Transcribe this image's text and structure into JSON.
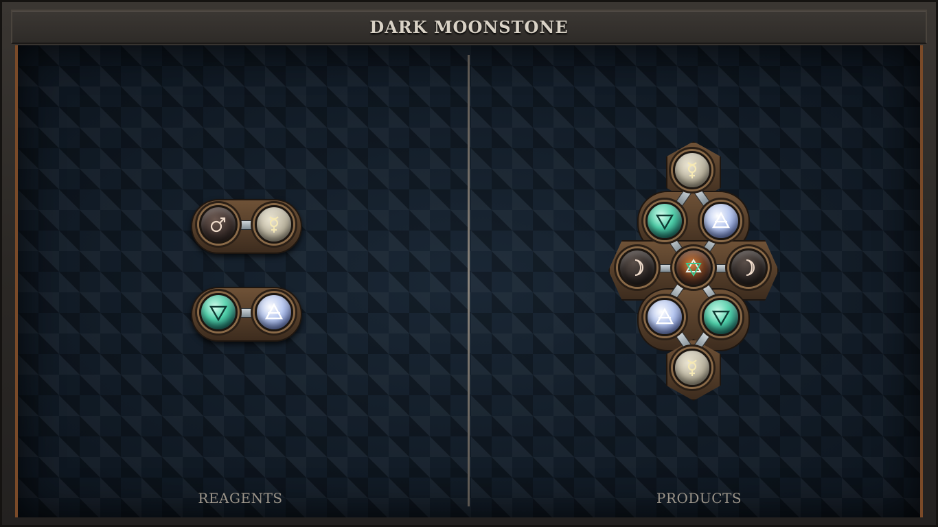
{
  "window": {
    "title": "DARK MOONSTONE"
  },
  "panels": {
    "left": {
      "label": "REAGENTS"
    },
    "right": {
      "label": "PRODUCTS"
    }
  },
  "reagents": [
    {
      "symbols": [
        "mars-icon",
        "mercury-icon"
      ]
    },
    {
      "symbols": [
        "water-icon",
        "air-icon"
      ]
    }
  ],
  "product": {
    "nodes": [
      "mercury-icon",
      "water-icon",
      "air-icon",
      "moon-icon",
      "hexagram-icon",
      "moon-icon",
      "air-icon",
      "water-icon",
      "mercury-icon"
    ]
  },
  "colors": {
    "accent": "#7a4a28",
    "title_text": "#d9d2c6",
    "label_text": "#9c958a",
    "board": "#0f1823"
  }
}
